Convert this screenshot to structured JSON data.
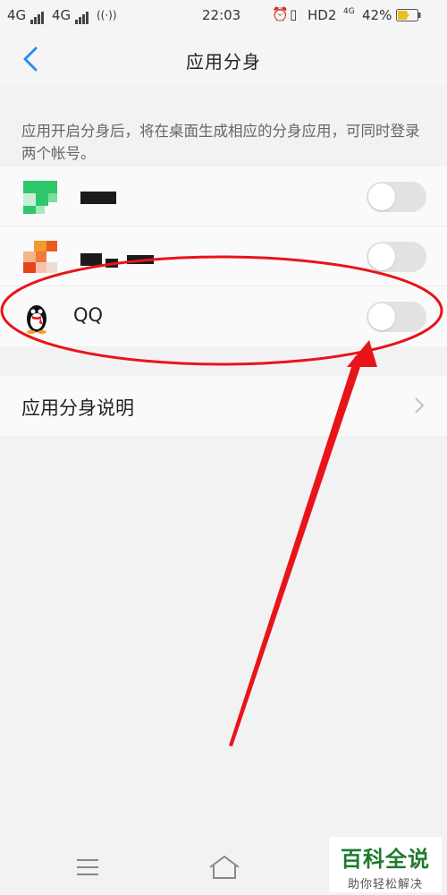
{
  "status_bar": {
    "network_1": "4G",
    "network_2": "4G",
    "time": "22:03",
    "hd": "HD2",
    "mini_4g": "4G",
    "battery": "42%"
  },
  "header": {
    "title": "应用分身"
  },
  "description": "应用开启分身后，将在桌面生成相应的分身应用，可同时登录两个帐号。",
  "apps": [
    {
      "name": "",
      "enabled": false,
      "icon": "wechat-icon"
    },
    {
      "name": "",
      "enabled": false,
      "icon": "weibo-icon"
    },
    {
      "name": "QQ",
      "enabled": false,
      "icon": "qq-penguin-icon"
    }
  ],
  "explanation": {
    "label": "应用分身说明"
  },
  "watermark": {
    "main": "百科全说",
    "sub": "助你轻松解决"
  },
  "colors": {
    "accent": "#2e8be8",
    "annotation_red": "#e8141a",
    "toggle_off": "#e2e2e2",
    "watermark_green": "#1f7a2e"
  }
}
